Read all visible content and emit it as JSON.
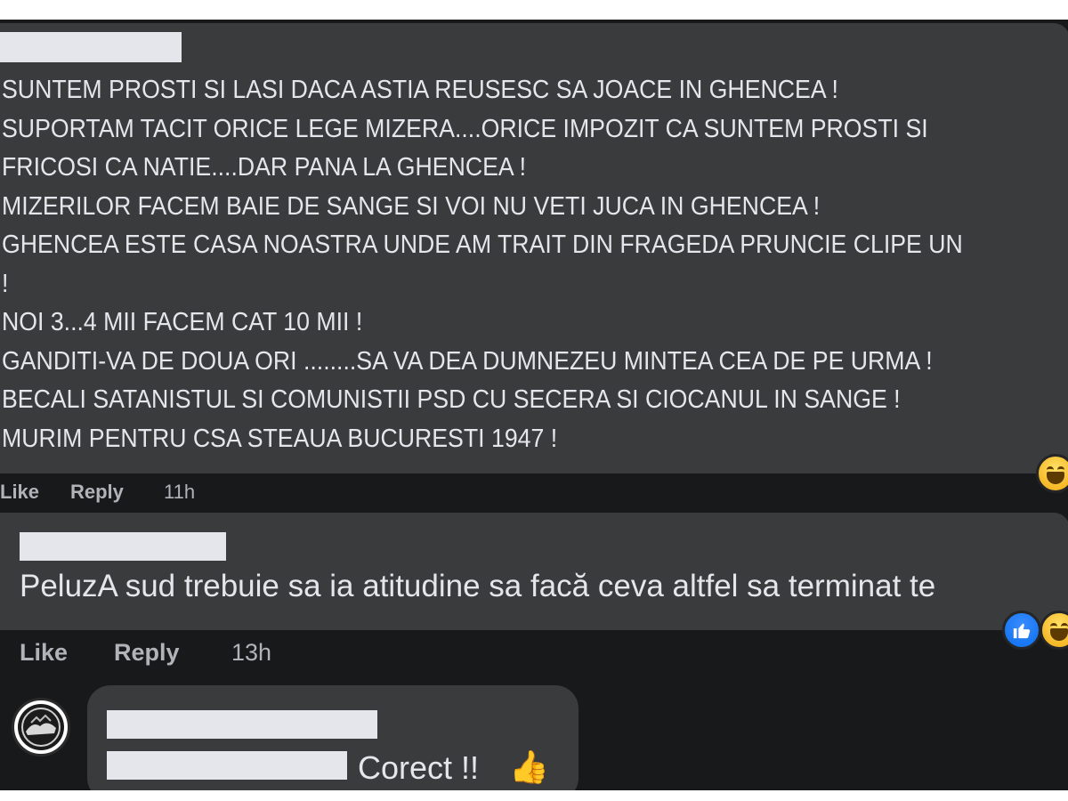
{
  "comment1": {
    "lines": [
      "SUNTEM PROSTI SI LASI DACA ASTIA REUSESC SA JOACE IN GHENCEA !",
      "SUPORTAM TACIT ORICE LEGE MIZERA....ORICE IMPOZIT CA SUNTEM PROSTI SI",
      "FRICOSI CA NATIE....DAR PANA LA GHENCEA !",
      "MIZERILOR FACEM BAIE DE SANGE SI VOI NU VETI JUCA IN GHENCEA !",
      "GHENCEA ESTE CASA NOASTRA UNDE AM TRAIT DIN FRAGEDA PRUNCIE CLIPE UN",
      "!",
      "NOI 3...4 MII FACEM CAT 10 MII !",
      "GANDITI-VA DE DOUA ORI ........SA VA DEA DUMNEZEU MINTEA CEA DE PE URMA !",
      "BECALI SATANISTUL SI COMUNISTII PSD CU SECERA SI CIOCANUL IN SANGE !",
      "MURIM PENTRU CSA STEAUA BUCURESTI 1947 !"
    ],
    "like_label": "Like",
    "reply_label": "Reply",
    "time": "11h",
    "reaction_icon": "haha-reaction-icon"
  },
  "comment2": {
    "text": "PeluzA sud trebuie sa ia atitudine sa facă ceva altfel sa terminat te",
    "like_label": "Like",
    "reply_label": "Reply",
    "time": "13h",
    "reaction_icons": [
      "like-reaction-icon",
      "haha-reaction-icon"
    ]
  },
  "comment3": {
    "text": "Corect !!",
    "emoji": "👍"
  },
  "colors": {
    "background": "#18191a",
    "bubble": "#3a3b3c",
    "text": "#e4e6eb",
    "muted": "#b0b3b8",
    "redaction": "#e4e6eb",
    "like_blue": "#1877f2",
    "haha_yellow": "#f7b928"
  }
}
